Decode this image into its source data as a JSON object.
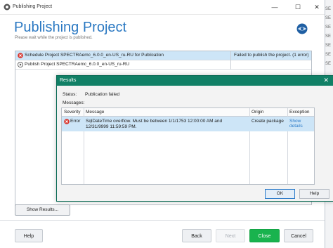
{
  "window": {
    "title": "Publishing Project",
    "minimize_glyph": "—",
    "maximize_glyph": "☐",
    "close_glyph": "✕"
  },
  "header": {
    "title": "Publishing Project",
    "subtitle": "Please wait while the project is published."
  },
  "tasks": [
    {
      "label": "Schedule Project SPECTRAemc_6.0.0_en-US_ru-RU for Publication",
      "status": "Failed to publish the project. (1 error)",
      "icon": "error-icon"
    },
    {
      "label": "Publish Project SPECTRAemc_6.0.0_en-US_ru-RU",
      "status": "",
      "icon": "play-icon"
    }
  ],
  "buttons": {
    "show_results": "Show Results...",
    "help": "Help",
    "back": "Back",
    "next": "Next",
    "close": "Close",
    "cancel": "Cancel"
  },
  "side_strip": [
    "SE",
    "SE",
    "SE",
    "SE",
    "SE",
    "SE",
    "SE"
  ],
  "dialog": {
    "title": "Results",
    "close_glyph": "✕",
    "status_label": "Status:",
    "status_value": "Publication failed",
    "messages_label": "Messages:",
    "columns": [
      "Severity",
      "Message",
      "Origin",
      "Exception"
    ],
    "rows": [
      {
        "severity": "Error",
        "message": "SqlDateTime overflow. Must be between 1/1/1753 12:00:00 AM and 12/31/9999 11:59:59 PM.",
        "origin": "Create package",
        "exception": "Show details"
      }
    ],
    "ok_label": "OK",
    "help_label": "Help"
  },
  "colors": {
    "accent": "#2a78c2",
    "dialog_title_bg": "#118066",
    "primary_button": "#19b34e",
    "selection": "#cde5f7",
    "error": "#d9342b"
  }
}
